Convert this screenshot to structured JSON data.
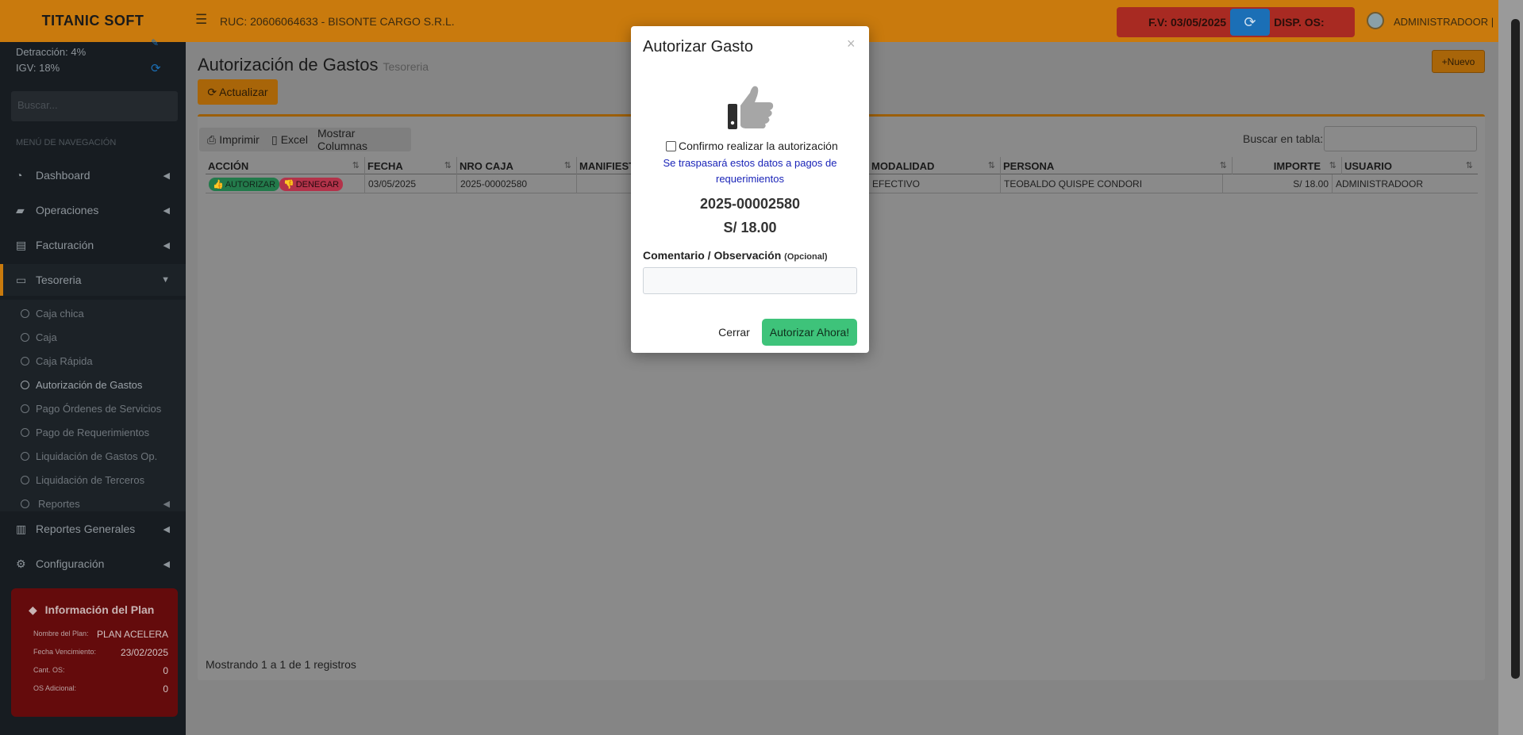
{
  "header": {
    "brand": "TITANIC SOFT",
    "ruc": "RUC: 20606064633 - BISONTE CARGO S.R.L.",
    "fv": "F.V: 03/05/2025",
    "disp": "DISP. OS:",
    "user": "ADMINISTRADOOR |"
  },
  "sidebar": {
    "detraccion": "Detracción: 4%",
    "igv": "IGV: 18%",
    "search_placeholder": "Buscar...",
    "menu_header": "MENÚ DE NAVEGACIÓN",
    "items": [
      {
        "label": "Dashboard"
      },
      {
        "label": "Operaciones"
      },
      {
        "label": "Facturación"
      },
      {
        "label": "Tesoreria"
      },
      {
        "label": "Reportes Generales"
      },
      {
        "label": "Configuración"
      }
    ],
    "sub_items": [
      {
        "label": "Caja chica"
      },
      {
        "label": "Caja"
      },
      {
        "label": "Caja Rápida"
      },
      {
        "label": "Autorización de Gastos"
      },
      {
        "label": "Pago Órdenes de Servicios"
      },
      {
        "label": "Pago de Requerimientos"
      },
      {
        "label": "Liquidación de Gastos Op."
      },
      {
        "label": "Liquidación de Terceros"
      },
      {
        "label": "Reportes"
      }
    ],
    "plan": {
      "title": "Información del Plan",
      "name_label": "Nombre del Plan:",
      "name_value": "PLAN ACELERA",
      "expiry_label": "Fecha Vencimiento:",
      "expiry_value": "23/02/2025",
      "os_label": "Cant. OS:",
      "os_value": "0",
      "extra_label": "OS Adicional:",
      "extra_value": "0"
    }
  },
  "main": {
    "title": "Autorización de Gastos",
    "subtitle": "Tesoreria",
    "new_button": "Nuevo",
    "refresh_button": "Actualizar",
    "toolbar": {
      "print": "Imprimir",
      "excel": "Excel",
      "columns": "Mostrar Columnas"
    },
    "search_label": "Buscar en tabla:",
    "table": {
      "headers": [
        "ACCIÓN",
        "FECHA",
        "NRO CAJA",
        "MANIFIEST",
        "MODALIDAD",
        "PERSONA",
        "IMPORTE",
        "USUARIO"
      ],
      "rows": [
        {
          "approve": "AUTORIZAR",
          "deny": "DENEGAR",
          "fecha": "03/05/2025",
          "nro_caja": "2025-00002580",
          "manifiesto": "",
          "modalidad": "EFECTIVO",
          "persona": "TEOBALDO QUISPE CONDORI",
          "importe": "S/ 18.00",
          "usuario": "ADMINISTRADOOR"
        }
      ]
    },
    "showing": "Mostrando 1 a 1 de 1 registros"
  },
  "modal": {
    "title": "Autorizar Gasto",
    "close": "×",
    "confirm_label": "Confirmo realizar la autorización",
    "info": "Se traspasará estos datos a pagos de requerimientos",
    "code": "2025-00002580",
    "amount": "S/ 18.00",
    "comment_label": "Comentario / Observación",
    "comment_optional": "(Opcional)",
    "comment_value": "",
    "cancel": "Cerrar",
    "submit": "Autorizar Ahora!"
  }
}
